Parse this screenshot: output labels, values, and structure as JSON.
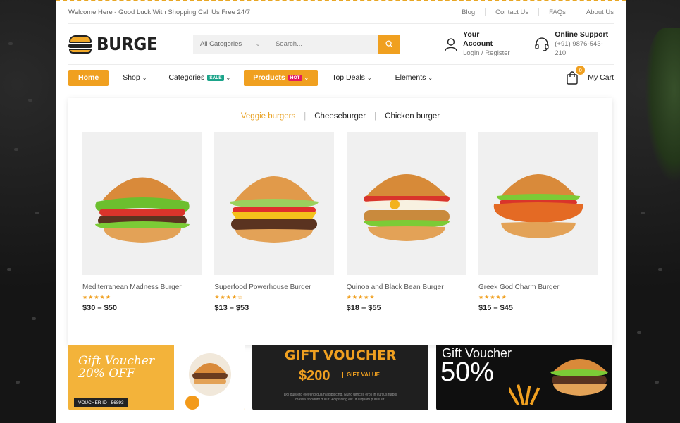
{
  "topbar": {
    "welcome": "Welcome Here - Good Luck With Shopping Call Us Free 24/7",
    "links": [
      "Blog",
      "Contact Us",
      "FAQs",
      "About Us"
    ]
  },
  "header": {
    "logo_text": "BURGE",
    "search": {
      "category": "All Categories",
      "placeholder": "Search..."
    },
    "account": {
      "title": "Your Account",
      "sub": "Login / Register"
    },
    "support": {
      "title": "Online Support",
      "sub": "(+91) 9876-543-210"
    }
  },
  "nav": {
    "home": "Home",
    "shop": "Shop",
    "categories": "Categories",
    "categories_badge": "SALE",
    "products": "Products",
    "products_badge": "HOT",
    "top_deals": "Top Deals",
    "elements": "Elements",
    "cart_count": "0",
    "cart_label": "My Cart"
  },
  "mega": {
    "tabs": [
      "Veggie burgers",
      "Cheeseburger",
      "Chicken burger"
    ],
    "products": [
      {
        "name": "Mediterranean Madness Burger",
        "price": "$30 – $50",
        "stars": "★★★★★",
        "rating": 5
      },
      {
        "name": "Superfood Powerhouse Burger",
        "price": "$13 – $53",
        "stars": "★★★★☆",
        "rating": 4
      },
      {
        "name": "Quinoa and Black Bean Burger",
        "price": "$18 – $55",
        "stars": "★★★★★",
        "rating": 5
      },
      {
        "name": "Greek God Charm Burger",
        "price": "$15 – $45",
        "stars": "★★★★★",
        "rating": 5
      }
    ]
  },
  "vouchers": {
    "v1_title": "Gift Voucher",
    "v1_sub": "20% OFF",
    "v1_id": "VOUCHER ID - 56893",
    "v2_title": "GIFT VOUCHER",
    "v2_amount": "$200",
    "v2_label": "GIFT VALUE",
    "v2_fine": "Dol quis etc eleifend quam adipiscing. Nunc ultrices eros in cursus turpis massa tincidunt dui ut. Adipiscing elit ut aliquam purus sit.",
    "v3_title": "Gift Voucher",
    "v3_pct": "50%"
  },
  "colors": {
    "accent": "#f0a020",
    "sale": "#1ba48a",
    "hot": "#e3195f"
  }
}
